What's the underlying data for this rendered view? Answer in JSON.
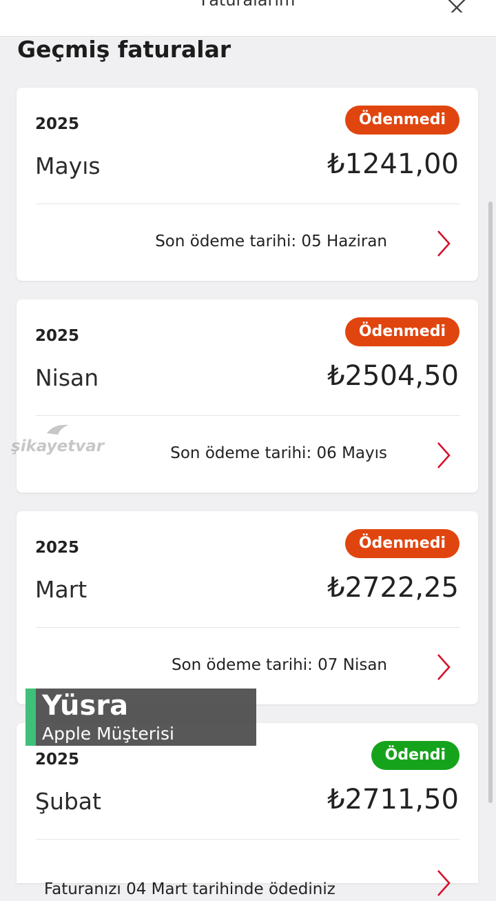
{
  "header": {
    "title": "Faturalarım",
    "close_icon": "close-icon"
  },
  "section_title": "Geçmiş faturalar",
  "colors": {
    "unpaid": "#e0450f",
    "paid": "#16a31c",
    "chevron": "#d4122c"
  },
  "invoices": [
    {
      "year": "2025",
      "status": "Ödenmedi",
      "month": "Mayıs",
      "amount": "₺1241,00",
      "due": "Son ödeme tarihi: 05 Haziran"
    },
    {
      "year": "2025",
      "status": "Ödenmedi",
      "month": "Nisan",
      "amount": "₺2504,50",
      "due": "Son ödeme tarihi: 06 Mayıs"
    },
    {
      "year": "2025",
      "status": "Ödenmedi",
      "month": "Mart",
      "amount": "₺2722,25",
      "due": "Son ödeme tarihi: 07 Nisan"
    },
    {
      "year": "2025",
      "status": "Ödendi",
      "month": "Şubat",
      "amount": "₺2711,50",
      "due": "Faturanızı 04 Mart tarihinde ödediniz"
    }
  ],
  "watermark": "şikayetvar",
  "overlay": {
    "name": "Yüsra",
    "role": "Apple Müşterisi"
  }
}
